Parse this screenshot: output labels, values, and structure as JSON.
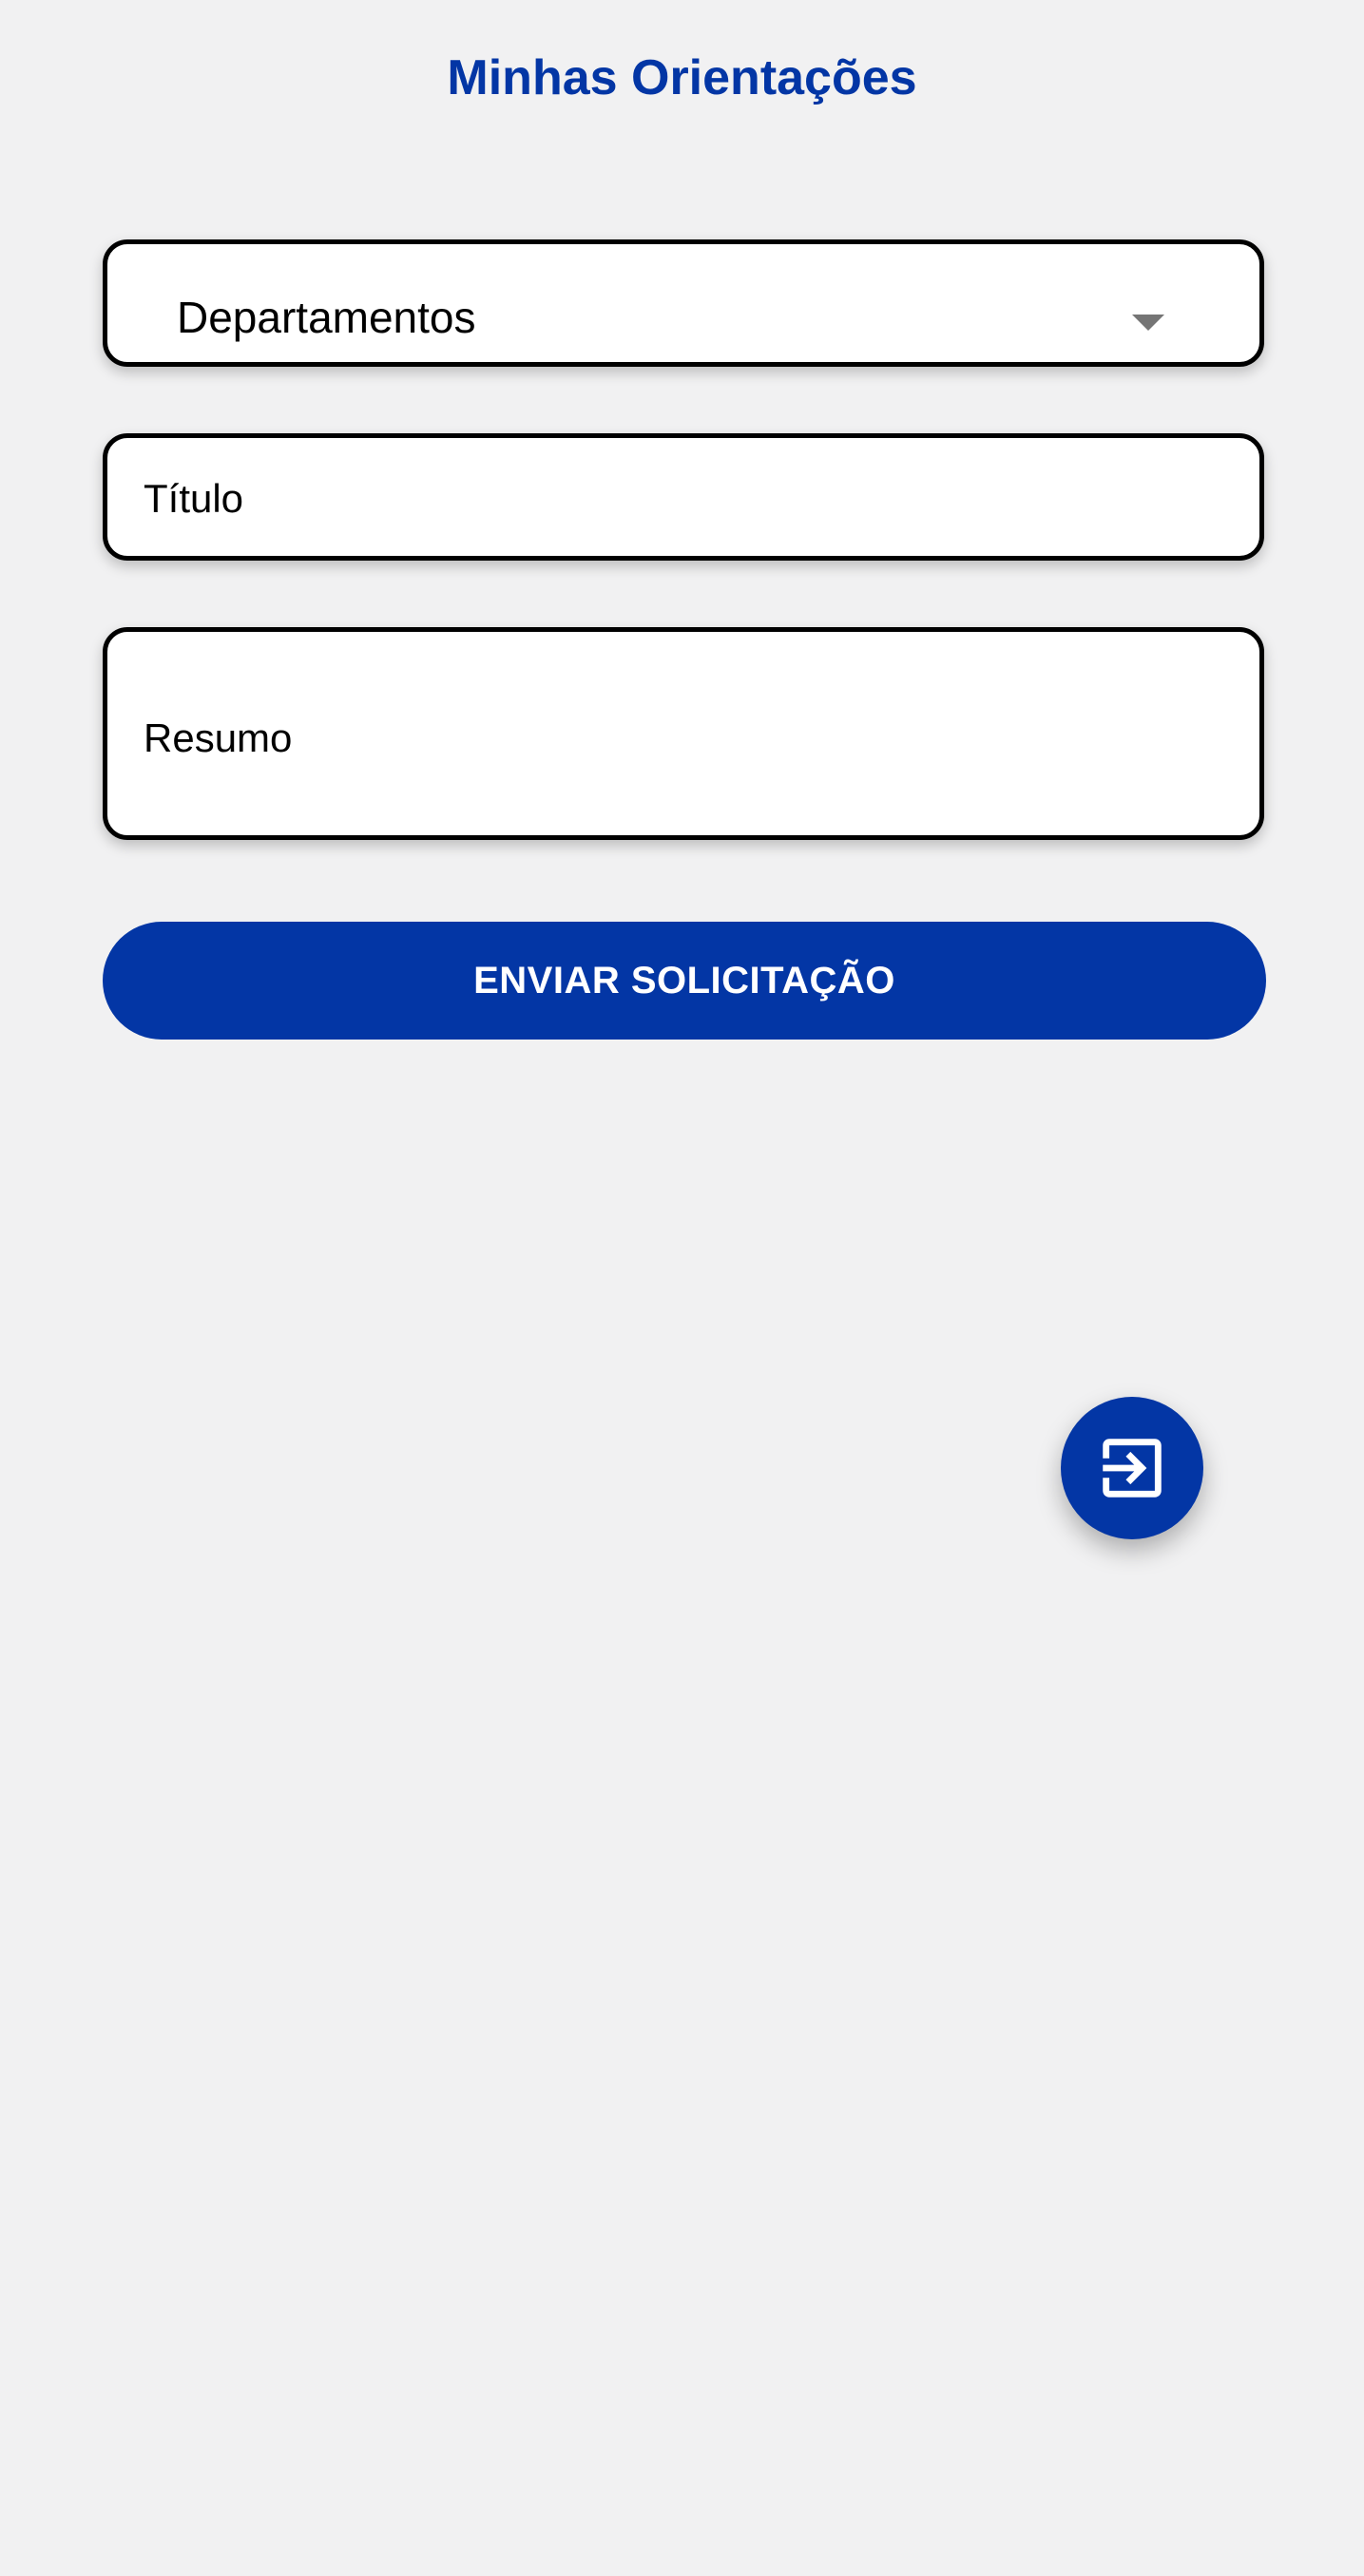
{
  "header": {
    "title": "Minhas Orientações"
  },
  "form": {
    "department_select": {
      "selected_label": "Departamentos"
    },
    "title_field": {
      "placeholder": "Título",
      "value": ""
    },
    "summary_field": {
      "placeholder": "Resumo",
      "value": ""
    },
    "submit_label": "ENVIAR SOLICITAÇÃO"
  },
  "fab": {
    "icon": "exit-to-app-icon"
  },
  "colors": {
    "background": "#f1f1f2",
    "accent": "#0336a5",
    "field_background": "#ffffff",
    "field_border": "#000000",
    "dropdown_arrow": "#757575"
  }
}
